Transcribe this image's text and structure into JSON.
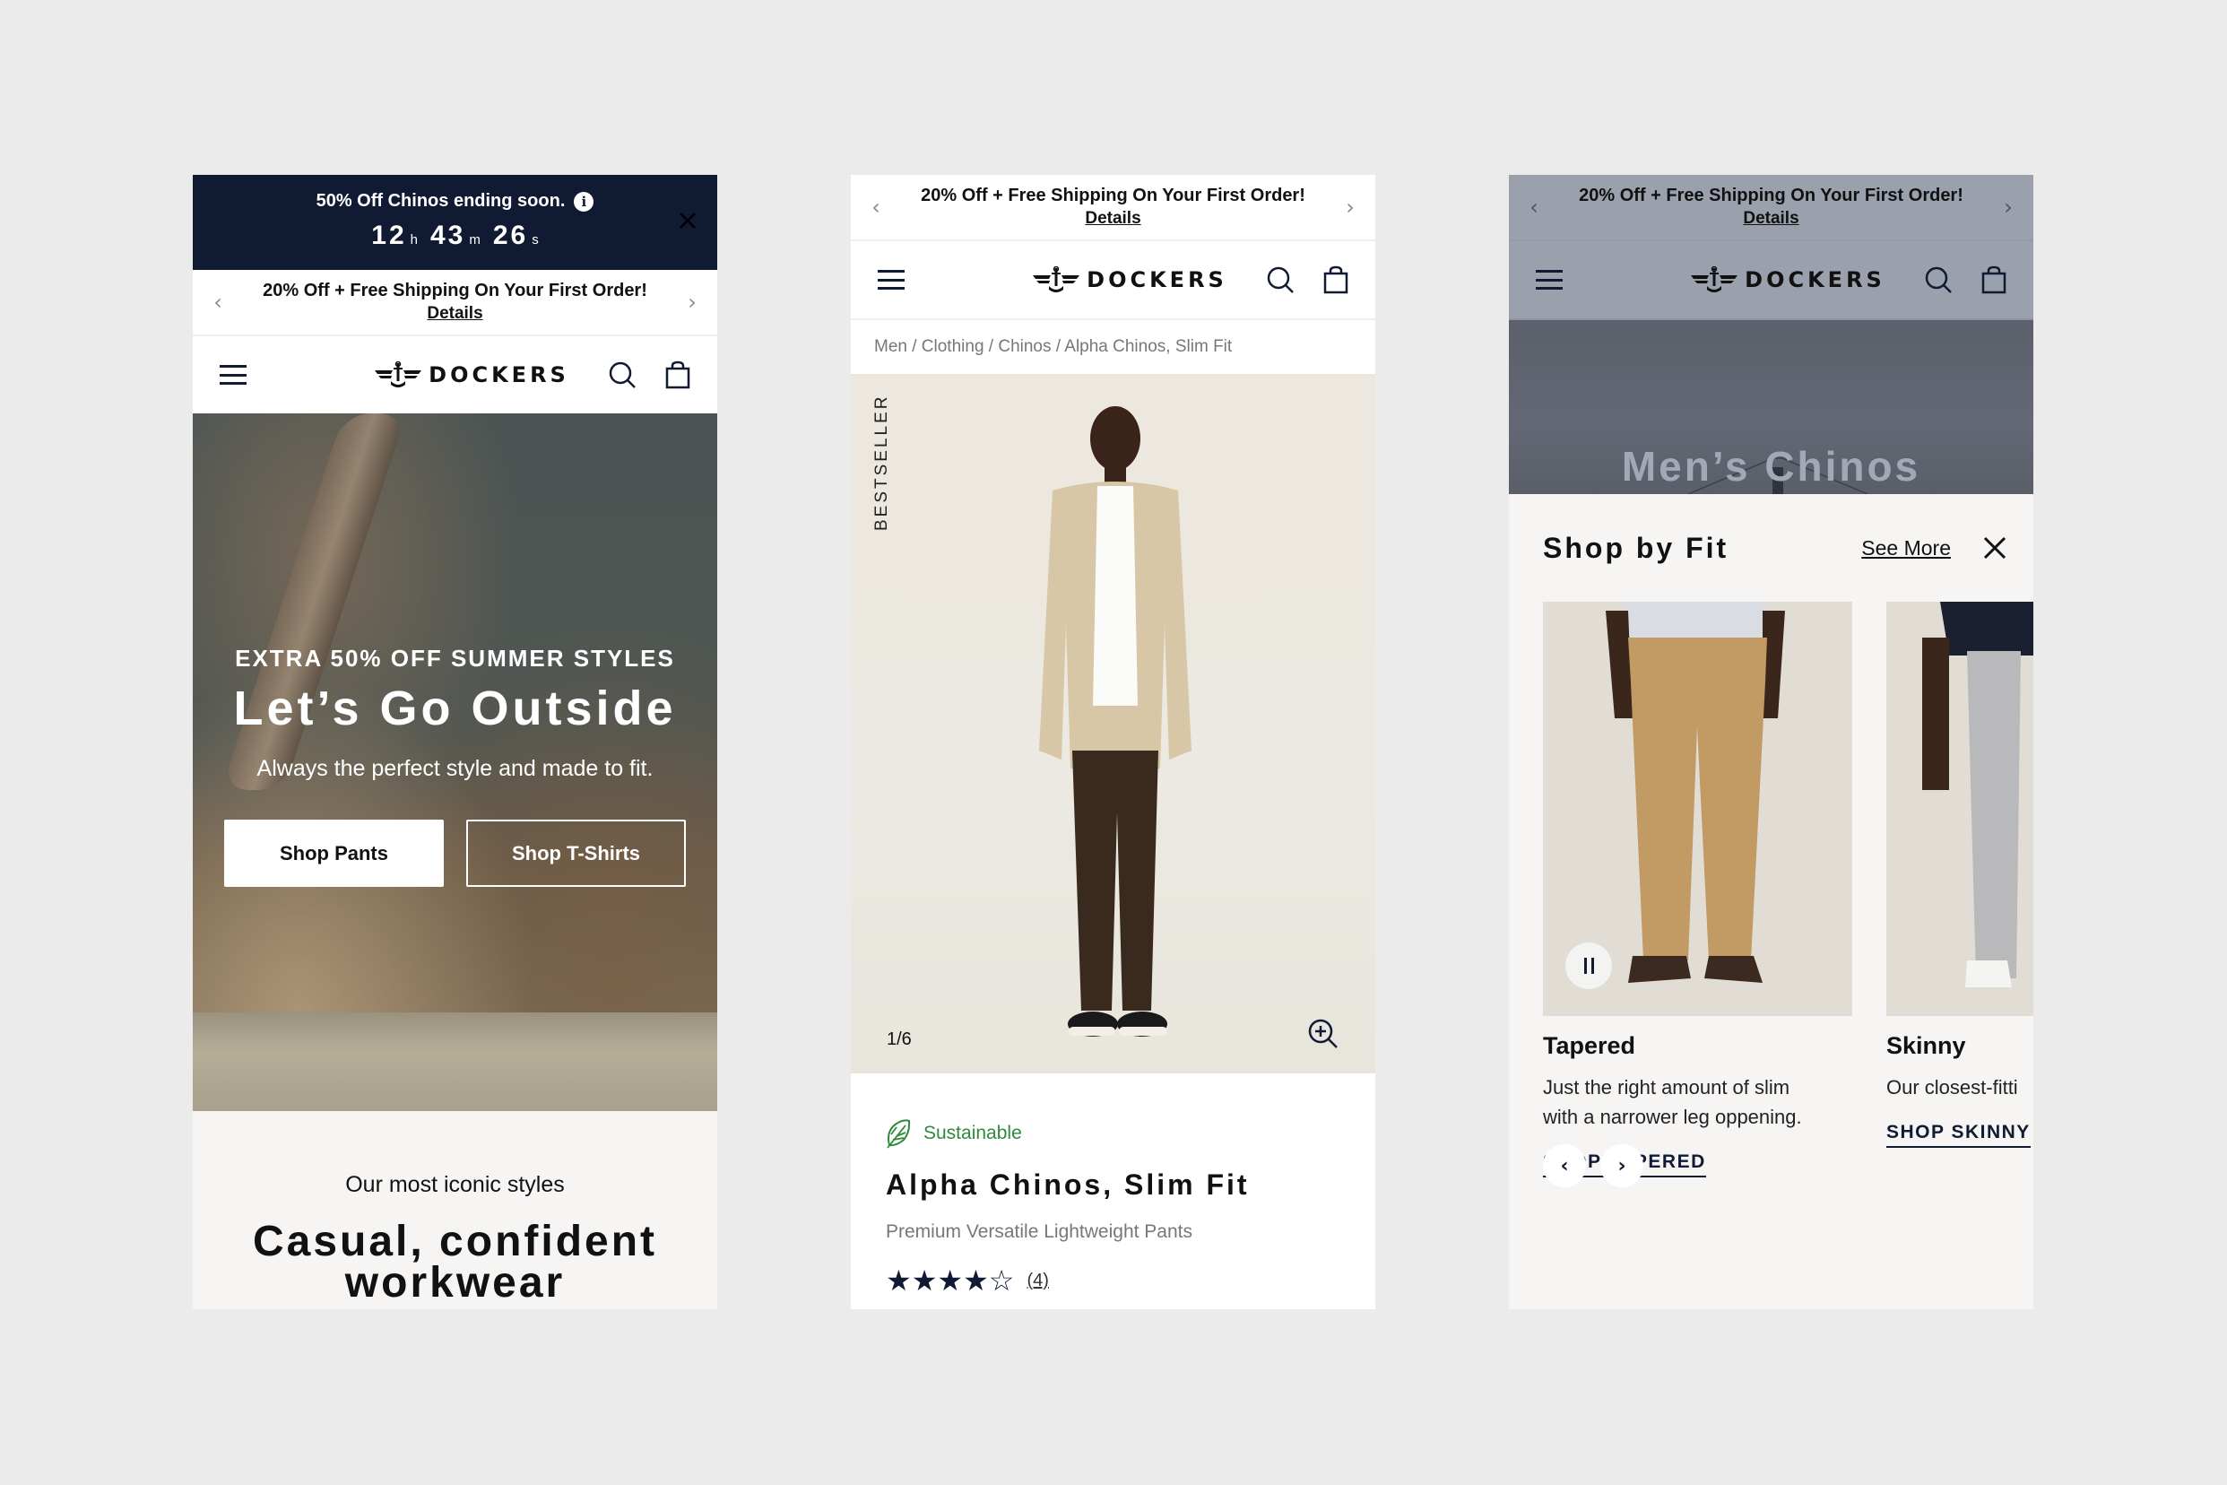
{
  "brand": {
    "name": "DOCKERS",
    "colors": {
      "navy": "#101b33",
      "background": "#ebebeb",
      "sustainable_green": "#2e8a3c",
      "cream": "#f7f5f3"
    }
  },
  "promo_bar": {
    "message": "20% Off + Free Shipping On Your First Order!",
    "details_link": "Details",
    "prev_icon": "chevron-left-icon",
    "next_icon": "chevron-right-icon"
  },
  "header": {
    "menu_icon": "hamburger-menu-icon",
    "logo_text": "DOCKERS",
    "search_icon": "search-icon",
    "bag_icon": "shopping-bag-icon"
  },
  "screen_home": {
    "countdown": {
      "title": "50% Off Chinos ending soon.",
      "hours": "12",
      "hours_unit": "h",
      "minutes": "43",
      "minutes_unit": "m",
      "seconds": "26",
      "seconds_unit": "s"
    },
    "hero": {
      "kicker": "EXTRA 50% OFF SUMMER STYLES",
      "headline": "Let’s Go Outside",
      "subtitle": "Always the perfect style and made to fit.",
      "primary_button": "Shop Pants",
      "secondary_button": "Shop T-Shirts"
    },
    "iconic": {
      "eyebrow": "Our most iconic styles",
      "title": "Casual, confident workwear"
    }
  },
  "screen_product": {
    "breadcrumb": "Men / Clothing / Chinos / Alpha Chinos, Slim Fit",
    "badge": "BESTSELLER",
    "image_counter": "1/6",
    "sustainable_label": "Sustainable",
    "title": "Alpha Chinos, Slim Fit",
    "subtitle": "Premium Versatile Lightweight Pants",
    "rating": {
      "stars": 4,
      "max": 5,
      "review_count": "(4)"
    }
  },
  "screen_fit": {
    "hero_title": "Men’s Chinos",
    "sheet_title": "Shop by Fit",
    "see_more": "See More",
    "fits": [
      {
        "name": "Tapered",
        "description_1": "Just the right amount of slim",
        "description_2": "with a narrower leg oppening.",
        "link": "SHOP TAPERED"
      },
      {
        "name": "Skinny",
        "description_1": "Our closest-fitti",
        "description_2": "",
        "link": "SHOP SKINNY"
      }
    ],
    "prev": "‹",
    "next": "›"
  }
}
